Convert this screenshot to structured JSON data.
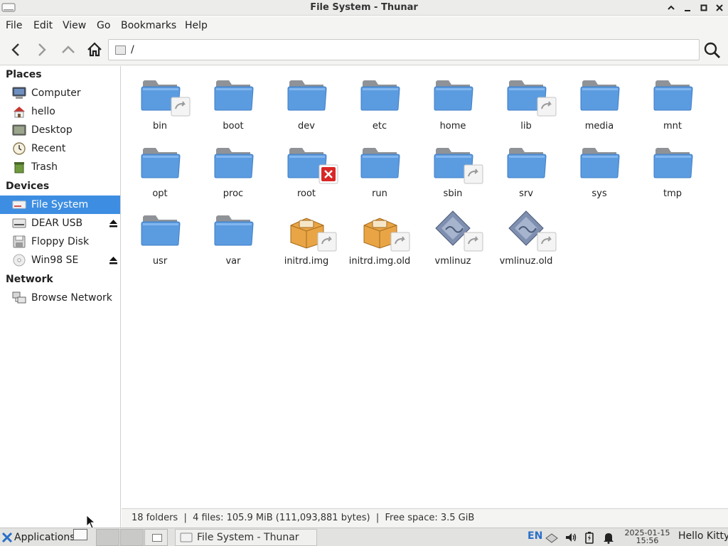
{
  "window": {
    "title": "File System - Thunar"
  },
  "menu": [
    "File",
    "Edit",
    "View",
    "Go",
    "Bookmarks",
    "Help"
  ],
  "location": {
    "path": "/"
  },
  "sidebar": {
    "places_heading": "Places",
    "places": [
      {
        "label": "Computer",
        "icon": "computer-icon"
      },
      {
        "label": "hello",
        "icon": "home-folder-icon"
      },
      {
        "label": "Desktop",
        "icon": "desktop-icon"
      },
      {
        "label": "Recent",
        "icon": "clock-icon"
      },
      {
        "label": "Trash",
        "icon": "trash-icon"
      }
    ],
    "devices_heading": "Devices",
    "devices": [
      {
        "label": "File System",
        "icon": "harddisk-icon",
        "selected": true
      },
      {
        "label": "DEAR USB",
        "icon": "usb-drive-icon",
        "eject": true
      },
      {
        "label": "Floppy Disk",
        "icon": "floppy-icon"
      },
      {
        "label": "Win98 SE",
        "icon": "cdrom-icon",
        "eject": true
      }
    ],
    "network_heading": "Network",
    "network": [
      {
        "label": "Browse Network",
        "icon": "network-icon"
      }
    ]
  },
  "files": [
    {
      "name": "bin",
      "type": "folder",
      "badge": "link"
    },
    {
      "name": "boot",
      "type": "folder"
    },
    {
      "name": "dev",
      "type": "folder"
    },
    {
      "name": "etc",
      "type": "folder"
    },
    {
      "name": "home",
      "type": "folder"
    },
    {
      "name": "lib",
      "type": "folder",
      "badge": "link"
    },
    {
      "name": "media",
      "type": "folder"
    },
    {
      "name": "mnt",
      "type": "folder"
    },
    {
      "name": "opt",
      "type": "folder"
    },
    {
      "name": "proc",
      "type": "folder"
    },
    {
      "name": "root",
      "type": "folder",
      "badge": "locked"
    },
    {
      "name": "run",
      "type": "folder"
    },
    {
      "name": "sbin",
      "type": "folder",
      "badge": "link"
    },
    {
      "name": "srv",
      "type": "folder"
    },
    {
      "name": "sys",
      "type": "folder"
    },
    {
      "name": "tmp",
      "type": "folder"
    },
    {
      "name": "usr",
      "type": "folder"
    },
    {
      "name": "var",
      "type": "folder"
    },
    {
      "name": "initrd.img",
      "type": "package",
      "badge": "link"
    },
    {
      "name": "initrd.img.old",
      "type": "package",
      "badge": "link"
    },
    {
      "name": "vmlinuz",
      "type": "kernel",
      "badge": "link"
    },
    {
      "name": "vmlinuz.old",
      "type": "kernel",
      "badge": "link"
    }
  ],
  "status": {
    "text": "18 folders  |  4 files: 105.9 MiB (111,093,881 bytes)  |  Free space: 3.5 GiB"
  },
  "taskbar": {
    "applications_label": "Applications",
    "task_label": "File System - Thunar",
    "lang": "EN",
    "date": "2025-01-15",
    "time": "15:56",
    "user": "Hello Kitty"
  },
  "colors": {
    "selection": "#3d8ee2",
    "folder_blue": "#5b9be0",
    "folder_back": "#8f9398"
  }
}
